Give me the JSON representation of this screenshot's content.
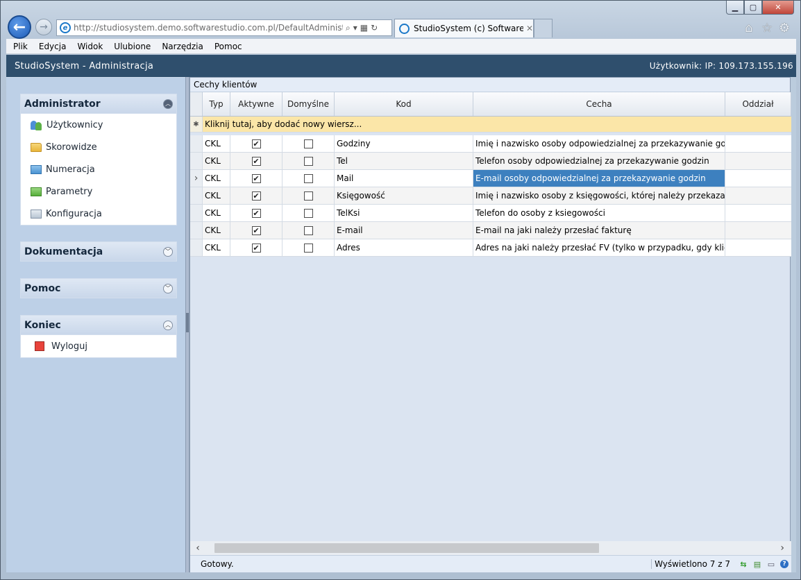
{
  "browser": {
    "url": "http://studiosystem.demo.softwarestudio.com.pl/DefaultAdministrator.as",
    "tab_title": "StudioSystem (c) SoftwareS...",
    "tab_close": "✕",
    "menu": [
      "Plik",
      "Edycja",
      "Widok",
      "Ulubione",
      "Narzędzia",
      "Pomoc"
    ]
  },
  "app": {
    "title": "StudioSystem - Administracja",
    "user_info": "Użytkownik: IP: 109.173.155.196"
  },
  "sidebar": {
    "administrator": {
      "title": "Administrator",
      "items": [
        {
          "label": "Użytkownicy",
          "icon": "users-icon"
        },
        {
          "label": "Skorowidze",
          "icon": "folder-yellow-icon"
        },
        {
          "label": "Numeracja",
          "icon": "folder-blue-icon"
        },
        {
          "label": "Parametry",
          "icon": "folder-green-icon"
        },
        {
          "label": "Konfiguracja",
          "icon": "folder-gray-icon"
        }
      ]
    },
    "dokumentacja": {
      "title": "Dokumentacja"
    },
    "pomoc": {
      "title": "Pomoc"
    },
    "koniec": {
      "title": "Koniec",
      "items": [
        {
          "label": "Wyloguj",
          "icon": "logout-icon"
        }
      ]
    }
  },
  "grid": {
    "caption": "Cechy klientów",
    "columns": [
      "Typ",
      "Aktywne",
      "Domyślne",
      "Kod",
      "Cecha",
      "Oddział"
    ],
    "new_row_text": "Kliknij tutaj, aby dodać nowy wiersz...",
    "rows": [
      {
        "typ": "CKL",
        "aktywne": true,
        "domyslne": false,
        "kod": "Godziny",
        "cecha": "Imię i nazwisko osoby odpowiedzialnej za przekazywanie godz",
        "oddzial": ""
      },
      {
        "typ": "CKL",
        "aktywne": true,
        "domyslne": false,
        "kod": "Tel",
        "cecha": "Telefon osoby odpowiedzialnej za przekazywanie godzin",
        "oddzial": ""
      },
      {
        "typ": "CKL",
        "aktywne": true,
        "domyslne": false,
        "kod": "Mail",
        "cecha": "E-mail osoby odpowiedzialnej za przekazywanie godzin",
        "oddzial": ""
      },
      {
        "typ": "CKL",
        "aktywne": true,
        "domyslne": false,
        "kod": "Księgowość",
        "cecha": "Imię i nazwisko osoby z księgowości, której należy przekazać f",
        "oddzial": ""
      },
      {
        "typ": "CKL",
        "aktywne": true,
        "domyslne": false,
        "kod": "TelKsi",
        "cecha": "Telefon do osoby z ksiegowości",
        "oddzial": ""
      },
      {
        "typ": "CKL",
        "aktywne": true,
        "domyslne": false,
        "kod": "E-mail",
        "cecha": "E-mail na jaki należy przesłać fakturę",
        "oddzial": ""
      },
      {
        "typ": "CKL",
        "aktywne": true,
        "domyslne": false,
        "kod": "Adres",
        "cecha": "Adres na jaki należy przesłać FV (tylko w przypadku, gdy klien",
        "oddzial": ""
      }
    ],
    "selected_row_index": 2
  },
  "status": {
    "text": "Gotowy.",
    "count": "Wyświetlono 7 z 7"
  },
  "colors": {
    "header_bg": "#2f4f6d",
    "selected": "#3d80bf",
    "new_row": "#fbe6a8"
  }
}
